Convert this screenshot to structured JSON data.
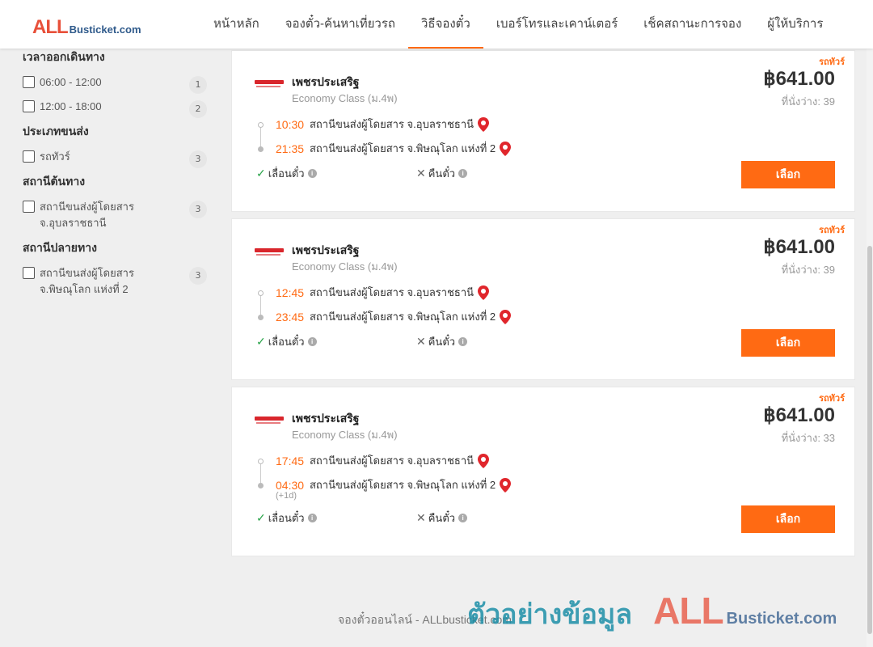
{
  "header": {
    "logo_all": "ALL",
    "logo_rest": "Busticket.com",
    "nav": [
      {
        "label": "หน้าหลัก"
      },
      {
        "label": "จองตั๋ว-ค้นหาเที่ยวรถ"
      },
      {
        "label": "วิธีจองตั๋ว",
        "active": true
      },
      {
        "label": "เบอร์โทรและเคาน์เตอร์"
      },
      {
        "label": "เช็คสถานะการจอง"
      },
      {
        "label": "ผู้ให้บริการ"
      }
    ]
  },
  "filters": {
    "departure_time": {
      "title": "เวลาออกเดินทาง",
      "options": [
        {
          "label": "06:00 - 12:00",
          "count": "1"
        },
        {
          "label": "12:00 - 18:00",
          "count": "2"
        }
      ]
    },
    "transport_type": {
      "title": "ประเภทขนส่ง",
      "options": [
        {
          "label": "รถทัวร์",
          "count": "3"
        }
      ]
    },
    "origin": {
      "title": "สถานีต้นทาง",
      "options": [
        {
          "label": "สถานีขนส่งผู้โดยสาร จ.อุบลราชธานี",
          "count": "3"
        }
      ]
    },
    "destination": {
      "title": "สถานีปลายทาง",
      "options": [
        {
          "label": "สถานีขนส่งผู้โดยสาร จ.พิษณุโลก แห่งที่ 2",
          "count": "3"
        }
      ]
    }
  },
  "results": [
    {
      "tag": "รถทัวร์",
      "operator": "เพชรประเสริฐ",
      "class": "Economy Class (ม.4พ)",
      "price": "฿641.00",
      "seats": "ที่นั่งว่าง: 39",
      "departure_time": "10:30",
      "departure_station": "สถานีขนส่งผู้โดยสาร จ.อุบลราชธานี",
      "arrival_time": "21:35",
      "arrival_station": "สถานีขนส่งผู้โดยสาร จ.พิษณุโลก แห่งที่ 2",
      "plus_day": "",
      "refund_label": "เลื่อนตั๋ว",
      "cancel_label": "คืนตั๋ว",
      "select_label": "เลือก"
    },
    {
      "tag": "รถทัวร์",
      "operator": "เพชรประเสริฐ",
      "class": "Economy Class (ม.4พ)",
      "price": "฿641.00",
      "seats": "ที่นั่งว่าง: 39",
      "departure_time": "12:45",
      "departure_station": "สถานีขนส่งผู้โดยสาร จ.อุบลราชธานี",
      "arrival_time": "23:45",
      "arrival_station": "สถานีขนส่งผู้โดยสาร จ.พิษณุโลก แห่งที่ 2",
      "plus_day": "",
      "refund_label": "เลื่อนตั๋ว",
      "cancel_label": "คืนตั๋ว",
      "select_label": "เลือก"
    },
    {
      "tag": "รถทัวร์",
      "operator": "เพชรประเสริฐ",
      "class": "Economy Class (ม.4พ)",
      "price": "฿641.00",
      "seats": "ที่นั่งว่าง: 33",
      "departure_time": "17:45",
      "departure_station": "สถานีขนส่งผู้โดยสาร จ.อุบลราชธานี",
      "arrival_time": "04:30",
      "arrival_station": "สถานีขนส่งผู้โดยสาร จ.พิษณุโลก แห่งที่ 2",
      "plus_day": "(+1d)",
      "refund_label": "เลื่อนตั๋ว",
      "cancel_label": "คืนตั๋ว",
      "select_label": "เลือก"
    }
  ],
  "footer": {
    "text": "จองตั๋วออนไลน์ - ALLbusticket.com"
  },
  "watermark": {
    "text": "ตัวอย่างข้อมูล",
    "all": "ALL",
    "rest": "Busticket.com"
  },
  "colors": {
    "accent": "#ff6a13",
    "brand_red": "#e8503a",
    "brand_blue": "#2f5a8b",
    "ok_green": "#2aa44a"
  },
  "icons": {
    "refund_ok": "check-icon",
    "cancel_no": "x-icon",
    "info": "info-icon",
    "location": "map-pin-icon"
  }
}
